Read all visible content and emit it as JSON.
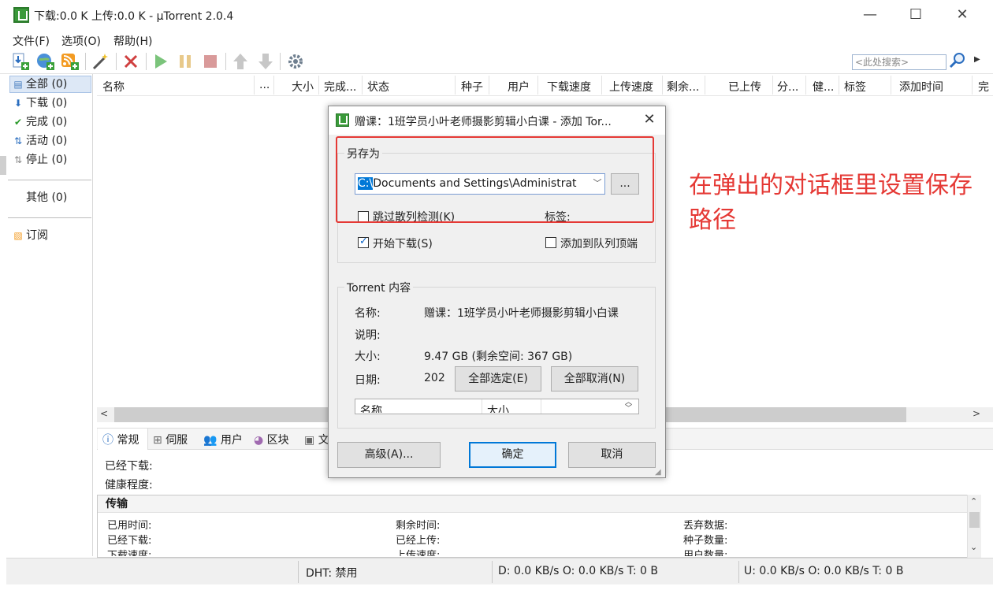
{
  "window": {
    "title": "下载:0.0 K 上传:0.0 K - µTorrent 2.0.4",
    "controls": {
      "minimize": "—",
      "maximize": "☐",
      "close": "✕"
    }
  },
  "menu": [
    "文件(F)",
    "选项(O)",
    "帮助(H)"
  ],
  "toolbar": {
    "icons": [
      "add-torrent-icon",
      "add-url-icon",
      "add-rss-icon",
      "create-torrent-icon",
      "remove-icon",
      "start-icon",
      "pause-icon",
      "stop-icon",
      "move-up-icon",
      "move-down-icon",
      "preferences-icon"
    ],
    "search_placeholder": "<此处搜索>"
  },
  "sidebar": {
    "items": [
      {
        "icon": "all-icon",
        "label": "全部 (0)"
      },
      {
        "icon": "download-icon",
        "label": "下载 (0)"
      },
      {
        "icon": "complete-icon",
        "label": "完成 (0)"
      },
      {
        "icon": "active-icon",
        "label": "活动 (0)"
      },
      {
        "icon": "inactive-icon",
        "label": "停止 (0)"
      },
      {
        "icon": "",
        "label": "其他 (0)"
      },
      {
        "icon": "rss-icon",
        "label": "订阅"
      }
    ]
  },
  "columns": [
    "名称",
    "...",
    "大小",
    "完成...",
    "状态",
    "种子",
    "用户",
    "下载速度",
    "上传速度",
    "剩余...",
    "已上传",
    "分...",
    "健...",
    "标签",
    "添加时间",
    "完"
  ],
  "detail_tabs": [
    "常规",
    "伺服",
    "用户",
    "区块",
    "文"
  ],
  "general": {
    "downloaded_label": "已经下载:",
    "health_label": "健康程度:"
  },
  "transfer": {
    "heading": "传输",
    "col1": [
      "已用时间:",
      "已经下载:",
      "下载速度:"
    ],
    "col2": [
      "剩余时间:",
      "已经上传:",
      "上传速度:"
    ],
    "col3": [
      "丢弃数据:",
      "种子数量:",
      "用户数量:"
    ]
  },
  "statusbar": {
    "dht": "DHT: 禁用",
    "down": "D: 0.0 KB/s O: 0.0 KB/s T: 0 B",
    "up": "U: 0.0 KB/s O: 0.0 KB/s T: 0 B"
  },
  "dialog": {
    "title": "赠课：1班学员小叶老师摄影剪辑小白课 - 添加 Tor...",
    "save_as_label": "另存为",
    "path_selected": "C:\\",
    "path_rest": "Documents and Settings\\Administrat",
    "browse_label": "...",
    "skip_hash_label": "跳过散列检测(K)",
    "skip_hash_checked": false,
    "label_label": "标签:",
    "start_download_label": "开始下载(S)",
    "start_download_checked": true,
    "add_top_label": "添加到队列顶端",
    "add_top_checked": false,
    "content_group": "Torrent 内容",
    "name_label": "名称:",
    "name_value": "赠课：1班学员小叶老师摄影剪辑小白课",
    "desc_label": "说明:",
    "size_label": "大小:",
    "size_value": "9.47 GB (剩余空间: 367 GB)",
    "date_label": "日期:",
    "date_value": "202",
    "select_all": "全部选定(E)",
    "deselect_all": "全部取消(N)",
    "file_cols": [
      "名称",
      "大小"
    ],
    "advanced": "高级(A)...",
    "ok": "确定",
    "cancel": "取消"
  },
  "annotation": "在弹出的对话框里设置保存路径",
  "colors": {
    "annotation_red": "#e53935",
    "accent_blue": "#0078d7"
  }
}
